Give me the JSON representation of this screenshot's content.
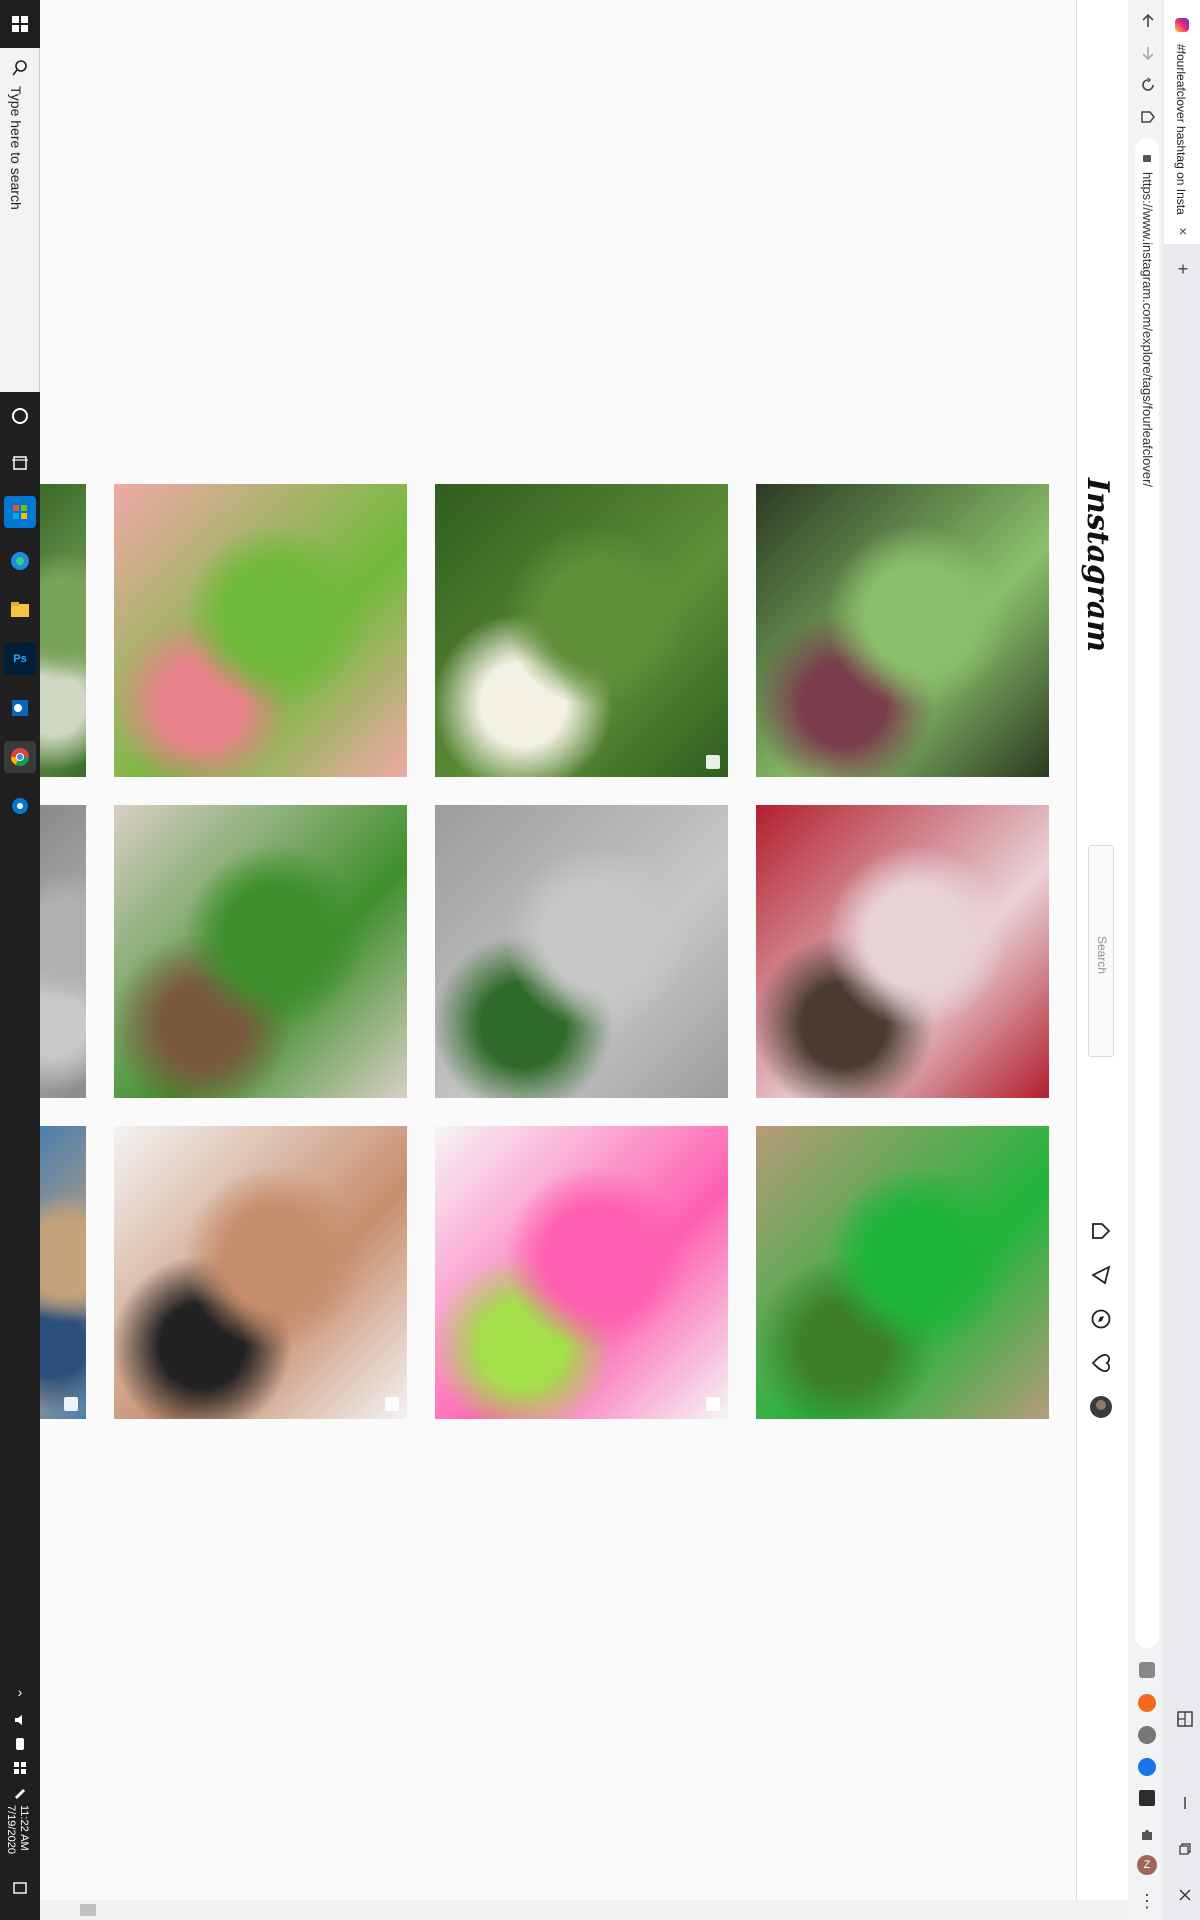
{
  "taskbar": {
    "search_placeholder": "Type here to search",
    "time": "11:22 AM",
    "date": "7/19/2020",
    "apps": [
      "start-icon",
      "search-icon",
      "cortana-icon",
      "task-view-icon",
      "store-icon",
      "edge-icon",
      "file-explorer-icon",
      "photoshop-icon",
      "outlook-icon",
      "chrome-icon",
      "settings-icon"
    ],
    "tray": [
      "chevron-up-icon",
      "volume-icon",
      "battery-icon",
      "network-icon",
      "pen-icon",
      "notification-icon"
    ]
  },
  "browser": {
    "tab_title": "#fourleafclover hashtag on Insta",
    "url": "https://www.instagram.com/explore/tags/fourleafclover/",
    "new_tab_label": "+",
    "close_tab_label": "×",
    "nav": [
      "back-icon",
      "forward-icon",
      "reload-icon",
      "bookmark-icon"
    ],
    "extensions": [
      "grammarly-icon",
      "ext-orange-icon",
      "ext-gray-icon",
      "ext-blue-icon",
      "ext-screen-icon",
      "puzzle-icon",
      "profile-z-icon",
      "menu-dots-icon"
    ],
    "window_controls": [
      "layout-icon",
      "minimize-icon",
      "restore-icon",
      "close-window-icon"
    ],
    "profile_letter": "Z",
    "menu_label": "⋮"
  },
  "instagram": {
    "logo": "Instagram",
    "search_placeholder": "Search",
    "nav_icons": [
      "home-icon",
      "direct-icon",
      "explore-icon",
      "activity-icon",
      "profile-avatar-icon"
    ]
  },
  "grid": {
    "rows": [
      {
        "tiles": [
          {
            "name": "clover-partial",
            "colors": [
              "#3a6b2a",
              "#7aa35a",
              "#cfd8c2"
            ]
          },
          {
            "name": "fingers-holding-clover",
            "colors": [
              "#f1a9a8",
              "#6fba3a",
              "#e8828a"
            ]
          },
          {
            "name": "clover-patch-white-flowers",
            "colors": [
              "#2f5d1e",
              "#5f8f38",
              "#f3f1e4"
            ]
          },
          {
            "name": "purple-center-clover",
            "colors": [
              "#2b3a22",
              "#8ac06b",
              "#7a3d4c"
            ]
          }
        ]
      },
      {
        "tiles": [
          {
            "name": "gray-partial",
            "colors": [
              "#8a8a8a",
              "#b0b0b0",
              "#c9c9c9"
            ]
          },
          {
            "name": "clover-over-animal",
            "colors": [
              "#d9cfc4",
              "#3e8f2c",
              "#7a5a3e"
            ]
          },
          {
            "name": "hand-clover-pavement",
            "colors": [
              "#9c9c9c",
              "#c7c7c7",
              "#2f6a2a"
            ]
          },
          {
            "name": "anime-fairy",
            "colors": [
              "#b31f2f",
              "#e8d2d6",
              "#4b3a2f"
            ]
          }
        ]
      },
      {
        "tiles": [
          {
            "name": "colorful-partial",
            "colors": [
              "#4a7fb0",
              "#c5a37a",
              "#2b4f7a"
            ]
          },
          {
            "name": "arm-tattoo",
            "colors": [
              "#f3f3f3",
              "#c78e6d",
              "#222222"
            ]
          },
          {
            "name": "paper-flower-craft",
            "colors": [
              "#f5f5f5",
              "#ff5fb0",
              "#a4e04a"
            ]
          },
          {
            "name": "green-cap-clover",
            "colors": [
              "#b79b7b",
              "#1fb53a",
              "#3e7f2a"
            ]
          }
        ]
      }
    ]
  }
}
